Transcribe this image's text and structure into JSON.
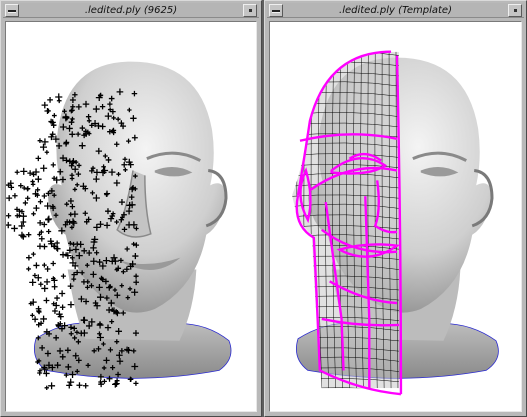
{
  "windows": [
    {
      "id": "left",
      "title": ".ledited.ply (9625)"
    },
    {
      "id": "right",
      "title": ".ledited.ply (Template)"
    }
  ],
  "colors": {
    "window_frame": "#b9b9b9",
    "viewport_bg": "#ffffff",
    "mesh_wire": "#ff00ff",
    "landmark_marker": "#000000",
    "shadow_edge": "#2a2ad0"
  }
}
